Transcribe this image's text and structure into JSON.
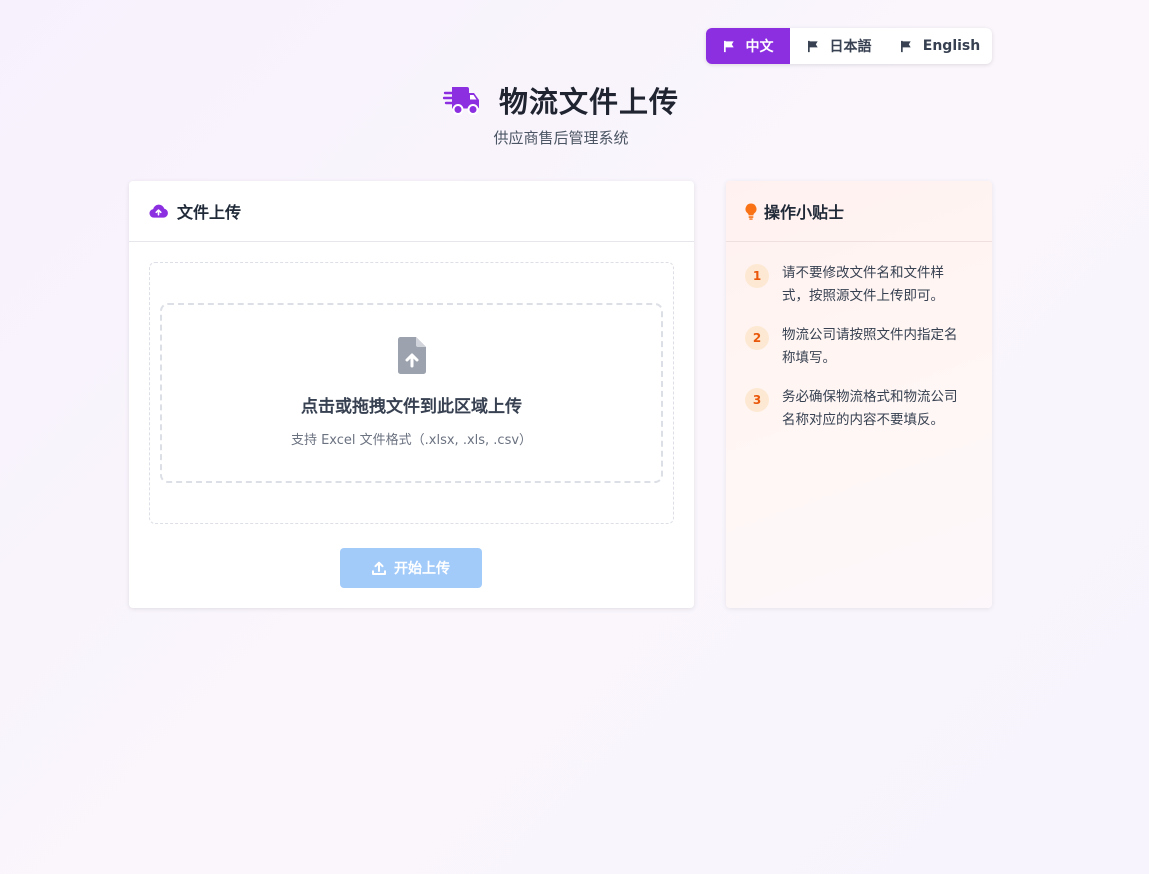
{
  "lang_switcher": {
    "items": [
      {
        "label": "中文",
        "active": true
      },
      {
        "label": "日本語",
        "active": false
      },
      {
        "label": "English",
        "active": false
      }
    ]
  },
  "header": {
    "title": "物流文件上传",
    "subtitle": "供应商售后管理系统",
    "icon": "truck-fast-icon"
  },
  "upload_card": {
    "title": "文件上传",
    "icon": "cloud-upload-icon",
    "drop_title": "点击或拖拽文件到此区域上传",
    "drop_hint": "支持 Excel 文件格式（.xlsx, .xls, .csv）",
    "button_label": "开始上传",
    "button_disabled": true
  },
  "tips_card": {
    "title": "操作小贴士",
    "icon": "lightbulb-icon",
    "items": [
      {
        "num": "1",
        "text": "请不要修改文件名和文件样式，按照源文件上传即可。"
      },
      {
        "num": "2",
        "text": "物流公司请按照文件内指定名称填写。"
      },
      {
        "num": "3",
        "text": "务必确保物流格式和物流公司名称对应的内容不要填反。"
      }
    ]
  },
  "colors": {
    "accent": "#8b2fe0",
    "button_disabled": "#a3cbfa",
    "tip_badge": "#ea580c"
  }
}
